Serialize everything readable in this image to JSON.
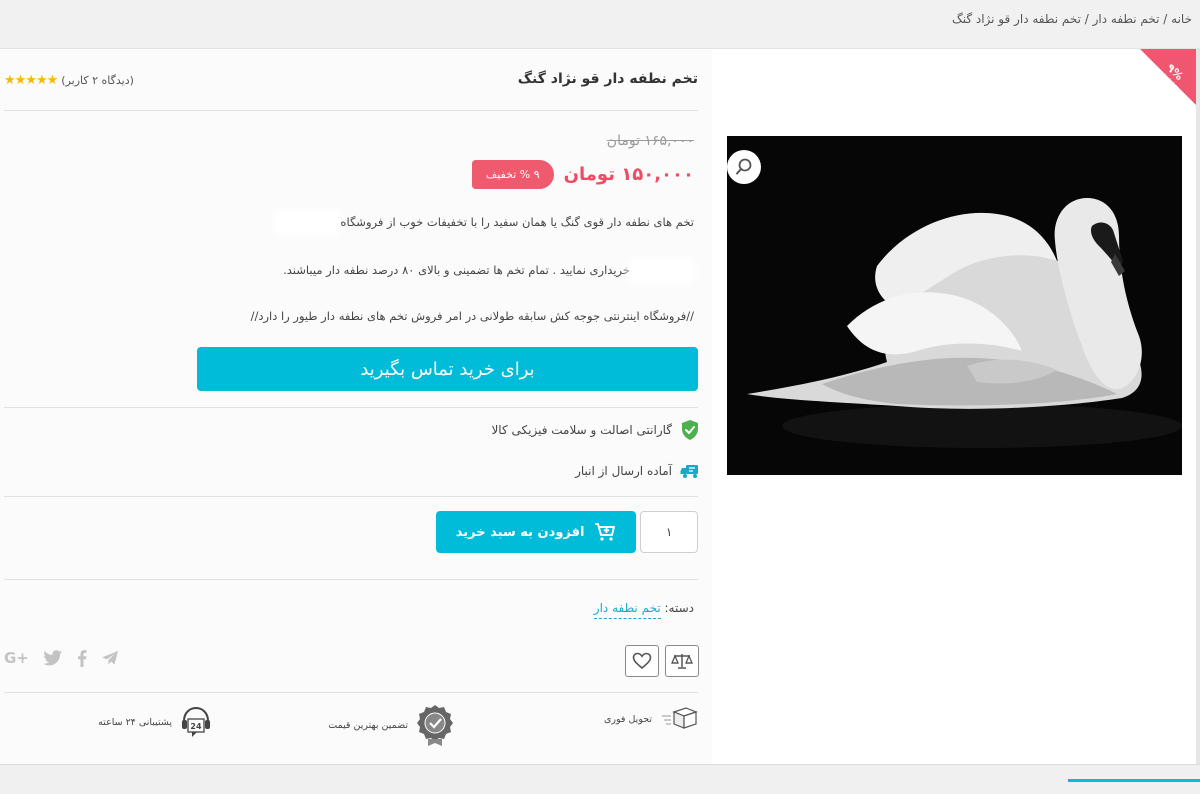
{
  "breadcrumb": {
    "home": "خانه",
    "sep1": " / ",
    "category": "تخم نطفه دار",
    "sep2": " / ",
    "current": "تخم نطفه دار قو نژاد گنگ"
  },
  "ribbon": {
    "percent": "۹%",
    "label": "تخفیف"
  },
  "product": {
    "title": "تخم نطفه دار قو نژاد گنگ",
    "rating_stars": "★★★★★",
    "rating_value": 5,
    "reviews_text": "(دیدگاه ۲ کاربر)",
    "old_price": "۱۶۵,۰۰۰ تومان",
    "new_price": "۱۵۰,۰۰۰ تومان",
    "discount_badge": "۹ % تخفیف",
    "desc_line1": "تخم های نطفه دار قوی گنگ یا همان سفید را با تخفیفات خوب از فروشگاه",
    "desc_line2": "خریداری نمایید . تمام تخم ها تضمینی و بالای ۸۰ درصد نطفه دار میباشند.",
    "desc_line3": "//فروشگاه اینترنتی جوجه کش سابقه طولانی در امر فروش تخم های نطفه دار طیور را دارد//",
    "contact_button": "برای خرید تماس بگیرید",
    "guarantee": "گارانتی اصالت و سلامت فیزیکی کالا",
    "ready": "آماده ارسال از انبار",
    "quantity": "۱",
    "add_to_cart": "افزودن به سبد خرید",
    "category_label": "دسته:",
    "category_value": "تخم نطفه دار"
  },
  "social": {
    "google": "G+"
  },
  "perks": {
    "delivery": "تحویل فوری",
    "best_price": "تضمین بهترین قیمت",
    "support": "پشتیبانی ۲۴ ساعته",
    "support_badge": "24"
  },
  "colors": {
    "accent": "#00bcd9",
    "sale": "#ef4c64",
    "star": "#f6b908",
    "guarantee": "#4caf50"
  }
}
